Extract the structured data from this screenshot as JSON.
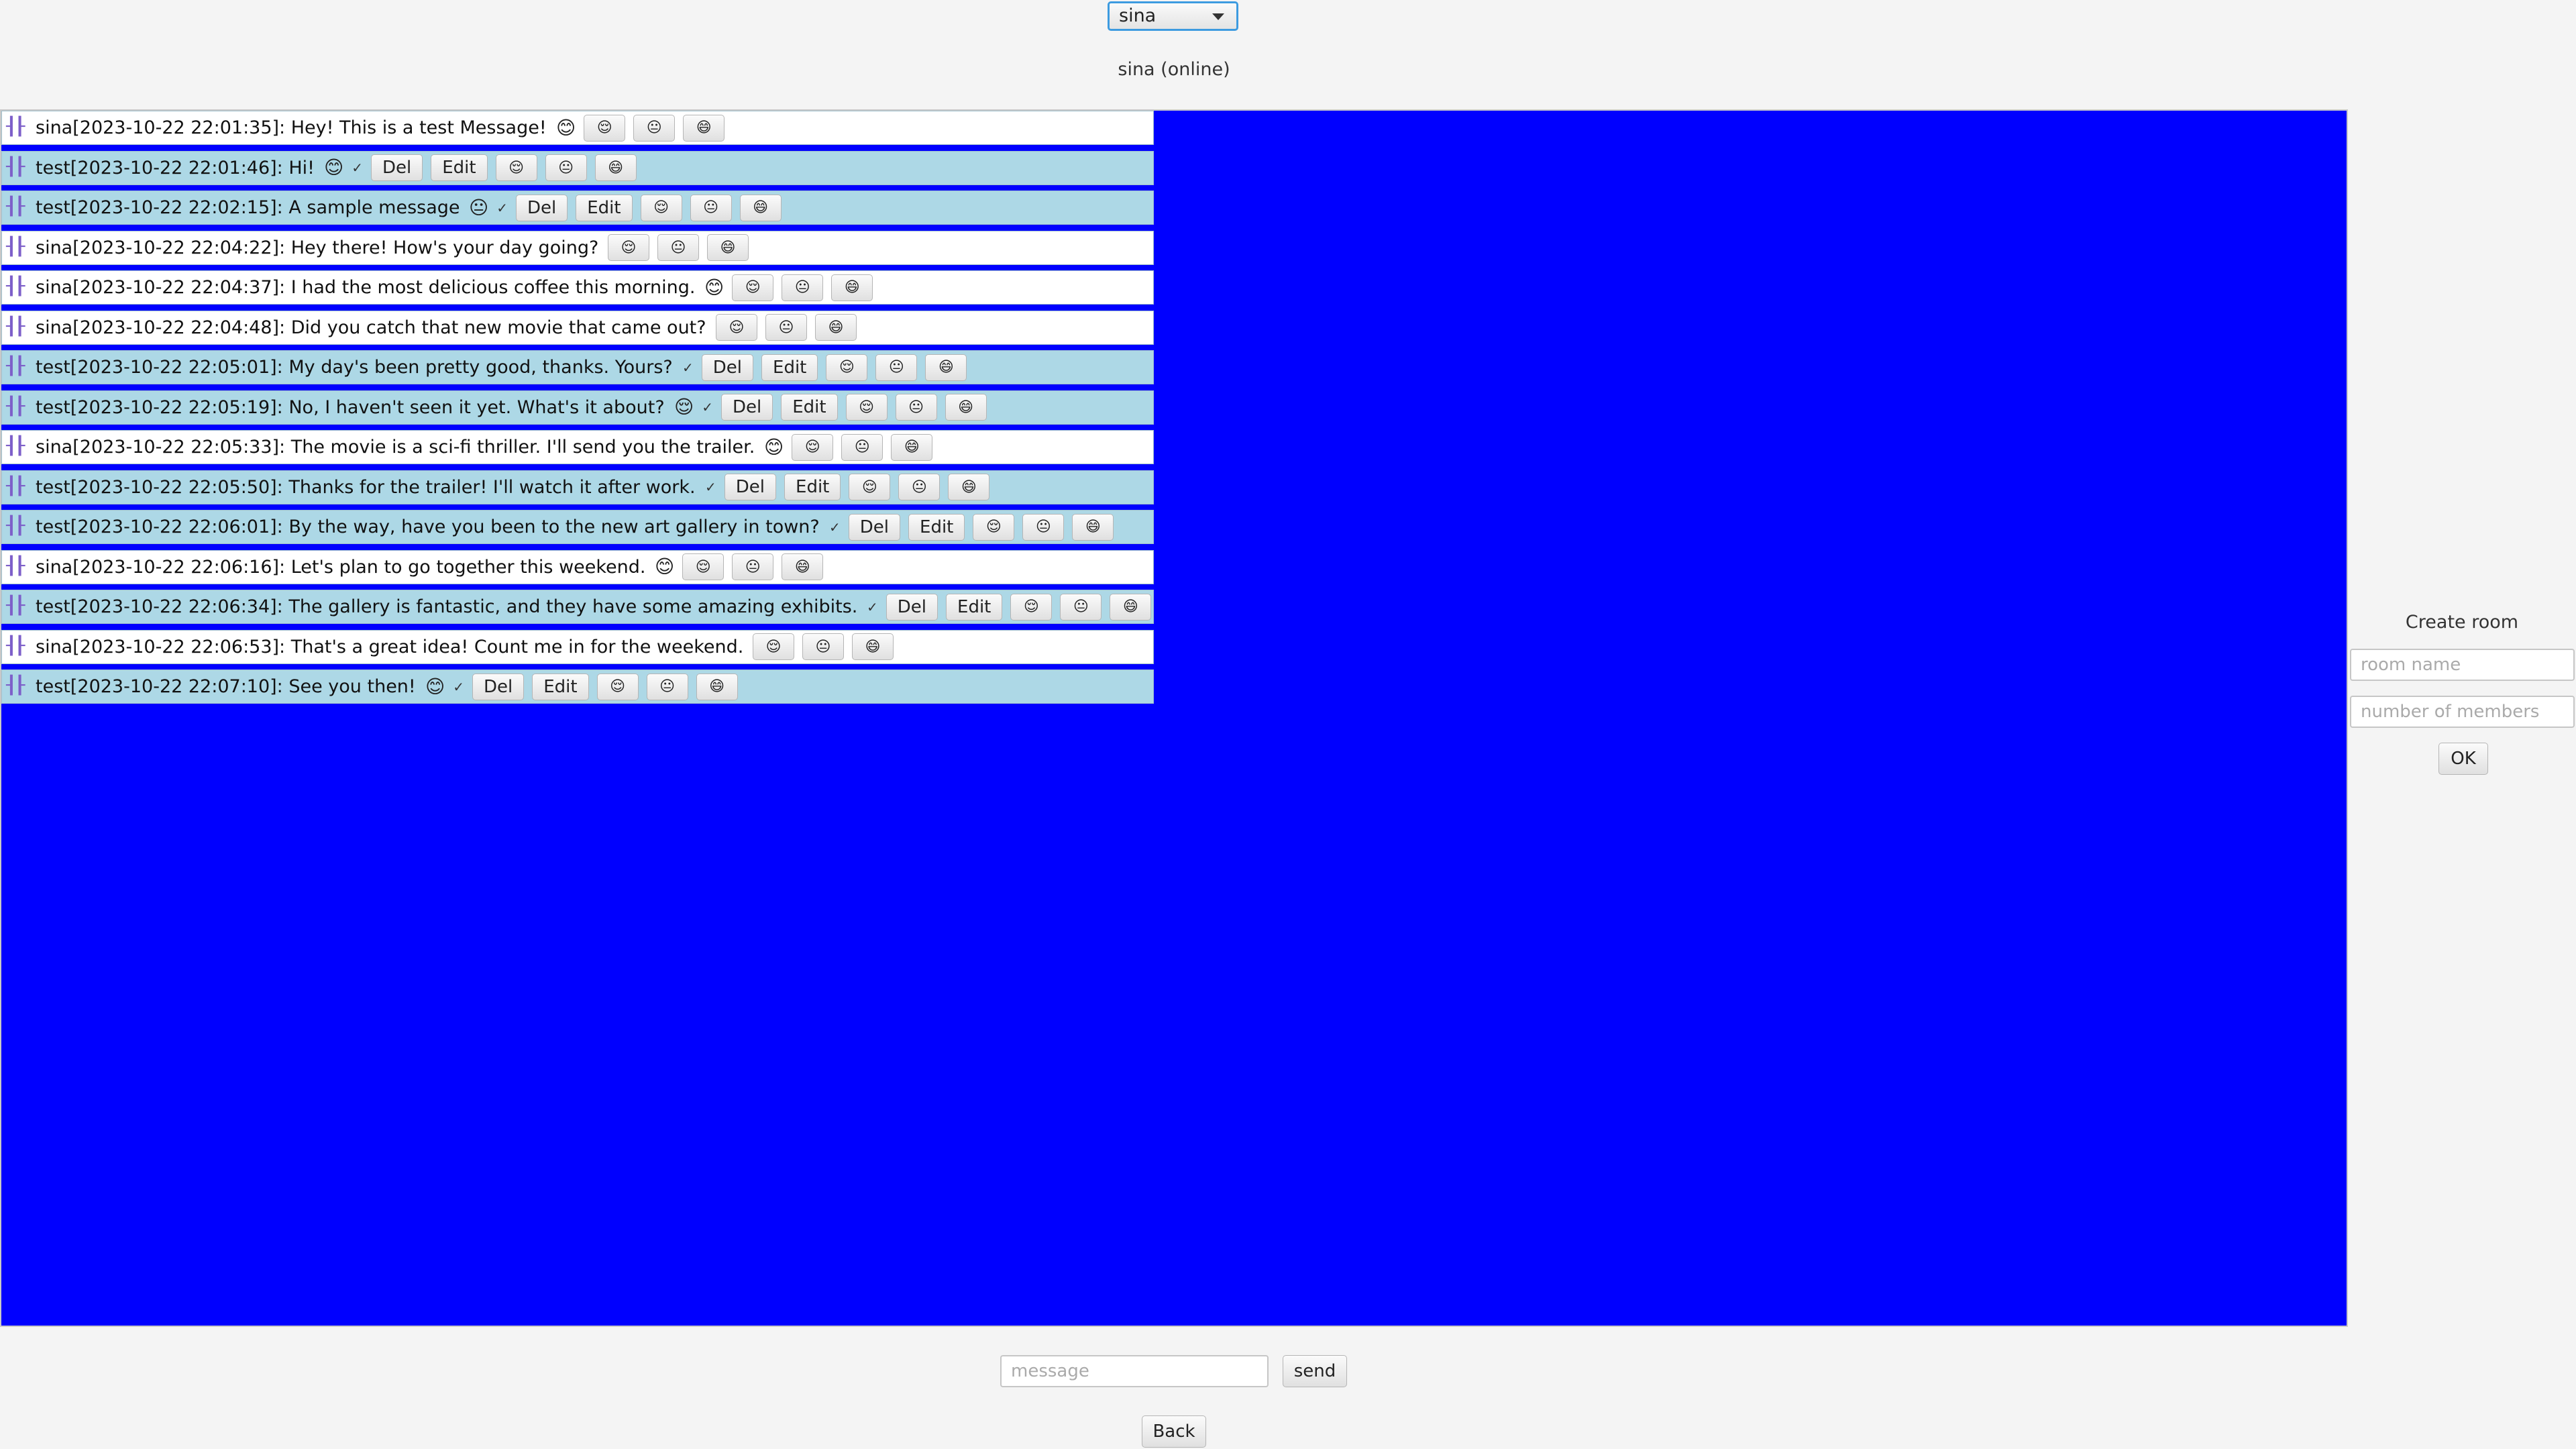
{
  "header": {
    "selected_user": "sina",
    "status": "sina (online)"
  },
  "messages": [
    {
      "text": "sina[2023-10-22 22:01:35]: Hey! This is a test Message!",
      "emoji": "😊",
      "own": true,
      "check": "",
      "actions": [],
      "reactions": [
        "😌",
        "😐",
        "😄"
      ]
    },
    {
      "text": "test[2023-10-22 22:01:46]: Hi!",
      "emoji": "😊",
      "own": false,
      "check": "✓",
      "actions": [
        "Del",
        "Edit"
      ],
      "reactions": [
        "😌",
        "😐",
        "😄"
      ]
    },
    {
      "text": "test[2023-10-22 22:02:15]: A sample message",
      "emoji": "😐",
      "own": false,
      "check": "✓",
      "actions": [
        "Del",
        "Edit"
      ],
      "reactions": [
        "😌",
        "😐",
        "😄"
      ]
    },
    {
      "text": "sina[2023-10-22 22:04:22]: Hey there! How's your day going?",
      "emoji": "",
      "own": true,
      "check": "",
      "actions": [],
      "reactions": [
        "😌",
        "😐",
        "😄"
      ]
    },
    {
      "text": "sina[2023-10-22 22:04:37]: I had the most delicious coffee this morning.",
      "emoji": "😊",
      "own": true,
      "check": "",
      "actions": [],
      "reactions": [
        "😌",
        "😐",
        "😄"
      ]
    },
    {
      "text": "sina[2023-10-22 22:04:48]: Did you catch that new movie that came out?",
      "emoji": "",
      "own": true,
      "check": "",
      "actions": [],
      "reactions": [
        "😌",
        "😐",
        "😄"
      ]
    },
    {
      "text": "test[2023-10-22 22:05:01]: My day's been pretty good, thanks. Yours?",
      "emoji": "",
      "own": false,
      "check": "✓",
      "actions": [
        "Del",
        "Edit"
      ],
      "reactions": [
        "😌",
        "😐",
        "😄"
      ]
    },
    {
      "text": "test[2023-10-22 22:05:19]: No, I haven't seen it yet. What's it about?",
      "emoji": "😌",
      "own": false,
      "check": "✓",
      "actions": [
        "Del",
        "Edit"
      ],
      "reactions": [
        "😌",
        "😐",
        "😄"
      ]
    },
    {
      "text": "sina[2023-10-22 22:05:33]: The movie is a sci-fi thriller. I'll send you the trailer.",
      "emoji": "😊",
      "own": true,
      "check": "",
      "actions": [],
      "reactions": [
        "😌",
        "😐",
        "😄"
      ]
    },
    {
      "text": "test[2023-10-22 22:05:50]: Thanks for the trailer! I'll watch it after work.",
      "emoji": "",
      "own": false,
      "check": "✓",
      "actions": [
        "Del",
        "Edit"
      ],
      "reactions": [
        "😌",
        "😐",
        "😄"
      ]
    },
    {
      "text": "test[2023-10-22 22:06:01]: By the way, have you been to the new art gallery in town?",
      "emoji": "",
      "own": false,
      "check": "✓",
      "actions": [
        "Del",
        "Edit"
      ],
      "reactions": [
        "😌",
        "😐",
        "😄"
      ]
    },
    {
      "text": "sina[2023-10-22 22:06:16]: Let's plan to go together this weekend.",
      "emoji": "😊",
      "own": true,
      "check": "",
      "actions": [],
      "reactions": [
        "😌",
        "😐",
        "😄"
      ]
    },
    {
      "text": "test[2023-10-22 22:06:34]: The gallery is fantastic, and they have some amazing exhibits.",
      "emoji": "",
      "own": false,
      "check": "✓",
      "actions": [
        "Del",
        "Edit"
      ],
      "reactions": [
        "😌",
        "😐",
        "😄"
      ]
    },
    {
      "text": "sina[2023-10-22 22:06:53]: That's a great idea! Count me in for the weekend.",
      "emoji": "",
      "own": true,
      "check": "",
      "actions": [],
      "reactions": [
        "😌",
        "😐",
        "😄"
      ]
    },
    {
      "text": "test[2023-10-22 22:07:10]: See you then!",
      "emoji": "😊",
      "own": false,
      "check": "✓",
      "actions": [
        "Del",
        "Edit"
      ],
      "reactions": [
        "😌",
        "😐",
        "😄"
      ]
    }
  ],
  "composer": {
    "message_placeholder": "message",
    "send_label": "send",
    "back_label": "Back"
  },
  "create_room": {
    "title": "Create room",
    "room_name_placeholder": "room name",
    "members_placeholder": "number of members",
    "ok_label": "OK"
  },
  "colors": {
    "chat_background": "#0000ff",
    "own_message": "#ffffff",
    "other_message": "#add8e6"
  }
}
